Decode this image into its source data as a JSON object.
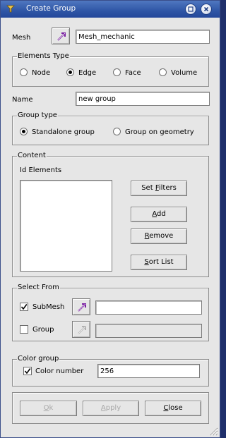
{
  "window": {
    "title": "Create Group"
  },
  "mesh": {
    "label": "Mesh",
    "value": "Mesh_mechanic",
    "select_icon": "arrow-select-icon"
  },
  "elements_type": {
    "title": "Elements Type",
    "options": [
      {
        "label": "Node",
        "selected": false
      },
      {
        "label": "Edge",
        "selected": true
      },
      {
        "label": "Face",
        "selected": false
      },
      {
        "label": "Volume",
        "selected": false
      }
    ]
  },
  "name": {
    "label": "Name",
    "value": "new group"
  },
  "group_type": {
    "title": "Group type",
    "options": [
      {
        "label": "Standalone group",
        "selected": true
      },
      {
        "label": "Group on geometry",
        "selected": false
      }
    ]
  },
  "content": {
    "title": "Content",
    "list_label": "Id Elements",
    "buttons": {
      "set_filters": {
        "pre": "Set ",
        "u": "F",
        "post": "ilters"
      },
      "add": {
        "pre": "",
        "u": "A",
        "post": "dd"
      },
      "remove": {
        "pre": "",
        "u": "R",
        "post": "emove"
      },
      "sort_list": {
        "pre": "",
        "u": "S",
        "post": "ort List"
      }
    }
  },
  "select_from": {
    "title": "Select From",
    "submesh": {
      "label": "SubMesh",
      "checked": true,
      "value": ""
    },
    "group": {
      "label": "Group",
      "checked": false,
      "value": ""
    }
  },
  "color_group": {
    "title": "Color group",
    "color_number": {
      "label": "Color number",
      "checked": true,
      "value": "256"
    }
  },
  "footer": {
    "ok": {
      "pre": "",
      "u": "O",
      "post": "k"
    },
    "apply": {
      "pre": "",
      "u": "A",
      "post": "pply"
    },
    "close": {
      "pre": "",
      "u": "C",
      "post": "lose"
    }
  },
  "colors": {
    "titlebar": "#2f56a6",
    "background": "#e6e6e6",
    "select_arrow": "#7a1fa2"
  }
}
